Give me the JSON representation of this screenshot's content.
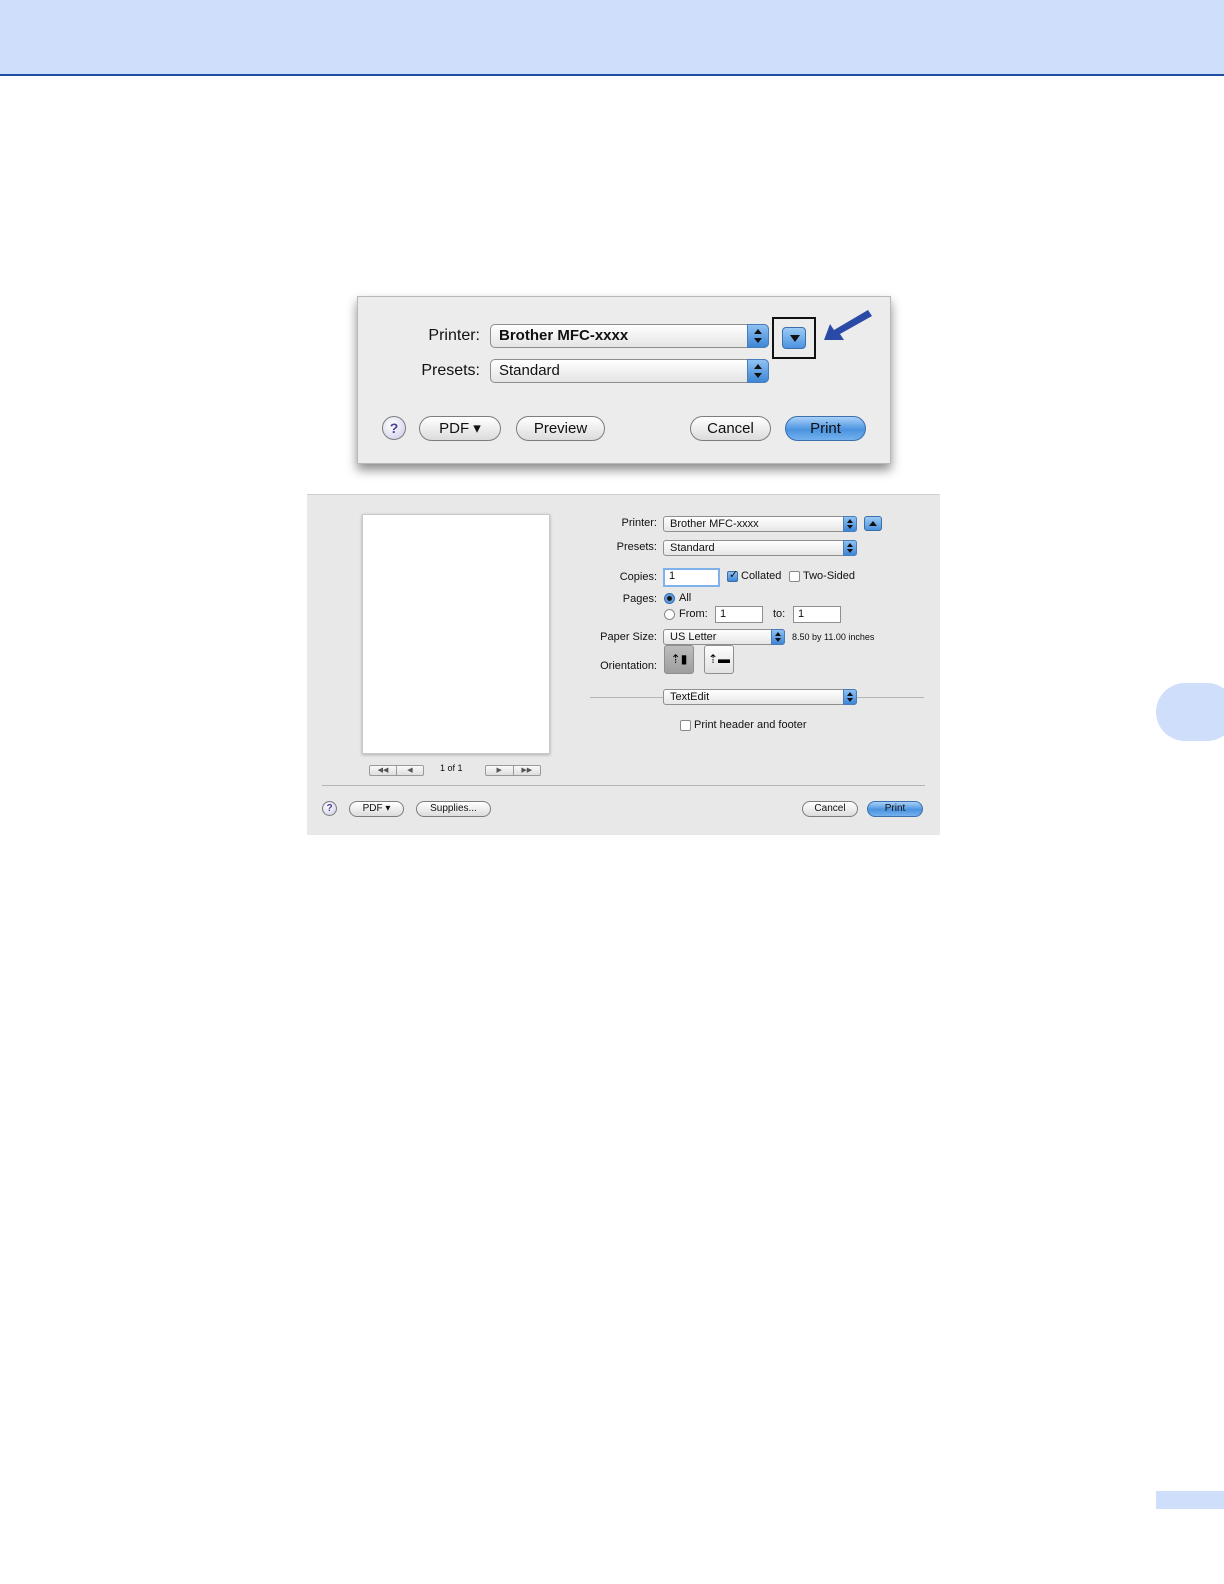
{
  "compact_dialog": {
    "printer_label": "Printer:",
    "printer_value": "Brother MFC-xxxx",
    "presets_label": "Presets:",
    "presets_value": "Standard",
    "help_label": "?",
    "pdf_label": "PDF ▾",
    "preview_label": "Preview",
    "cancel_label": "Cancel",
    "print_label": "Print"
  },
  "expanded_dialog": {
    "printer_label": "Printer:",
    "printer_value": "Brother MFC-xxxx",
    "presets_label": "Presets:",
    "presets_value": "Standard",
    "copies_label": "Copies:",
    "copies_value": "1",
    "collated_label": "Collated",
    "collated_checked": true,
    "two_sided_label": "Two-Sided",
    "two_sided_checked": false,
    "pages_label": "Pages:",
    "pages_all_label": "All",
    "pages_from_label": "From:",
    "pages_from_value": "1",
    "pages_to_label": "to:",
    "pages_to_value": "1",
    "paper_size_label": "Paper Size:",
    "paper_size_value": "US Letter",
    "paper_size_desc": "8.50 by 11.00 inches",
    "orientation_label": "Orientation:",
    "section_value": "TextEdit",
    "header_footer_label": "Print header and footer",
    "header_footer_checked": false,
    "page_counter": "1 of 1",
    "help_label": "?",
    "pdf_label": "PDF ▾",
    "supplies_label": "Supplies...",
    "cancel_label": "Cancel",
    "print_label": "Print"
  },
  "colors": {
    "header_band": "#cfdffb",
    "header_rule": "#1f4fa3",
    "callout_arrow": "#2b4aa8"
  },
  "icons": [
    "help-icon",
    "disclosure-triangle-icon",
    "callout-arrow-icon",
    "portrait-orientation-icon",
    "landscape-orientation-icon",
    "first-page-icon",
    "previous-page-icon",
    "next-page-icon",
    "last-page-icon"
  ]
}
